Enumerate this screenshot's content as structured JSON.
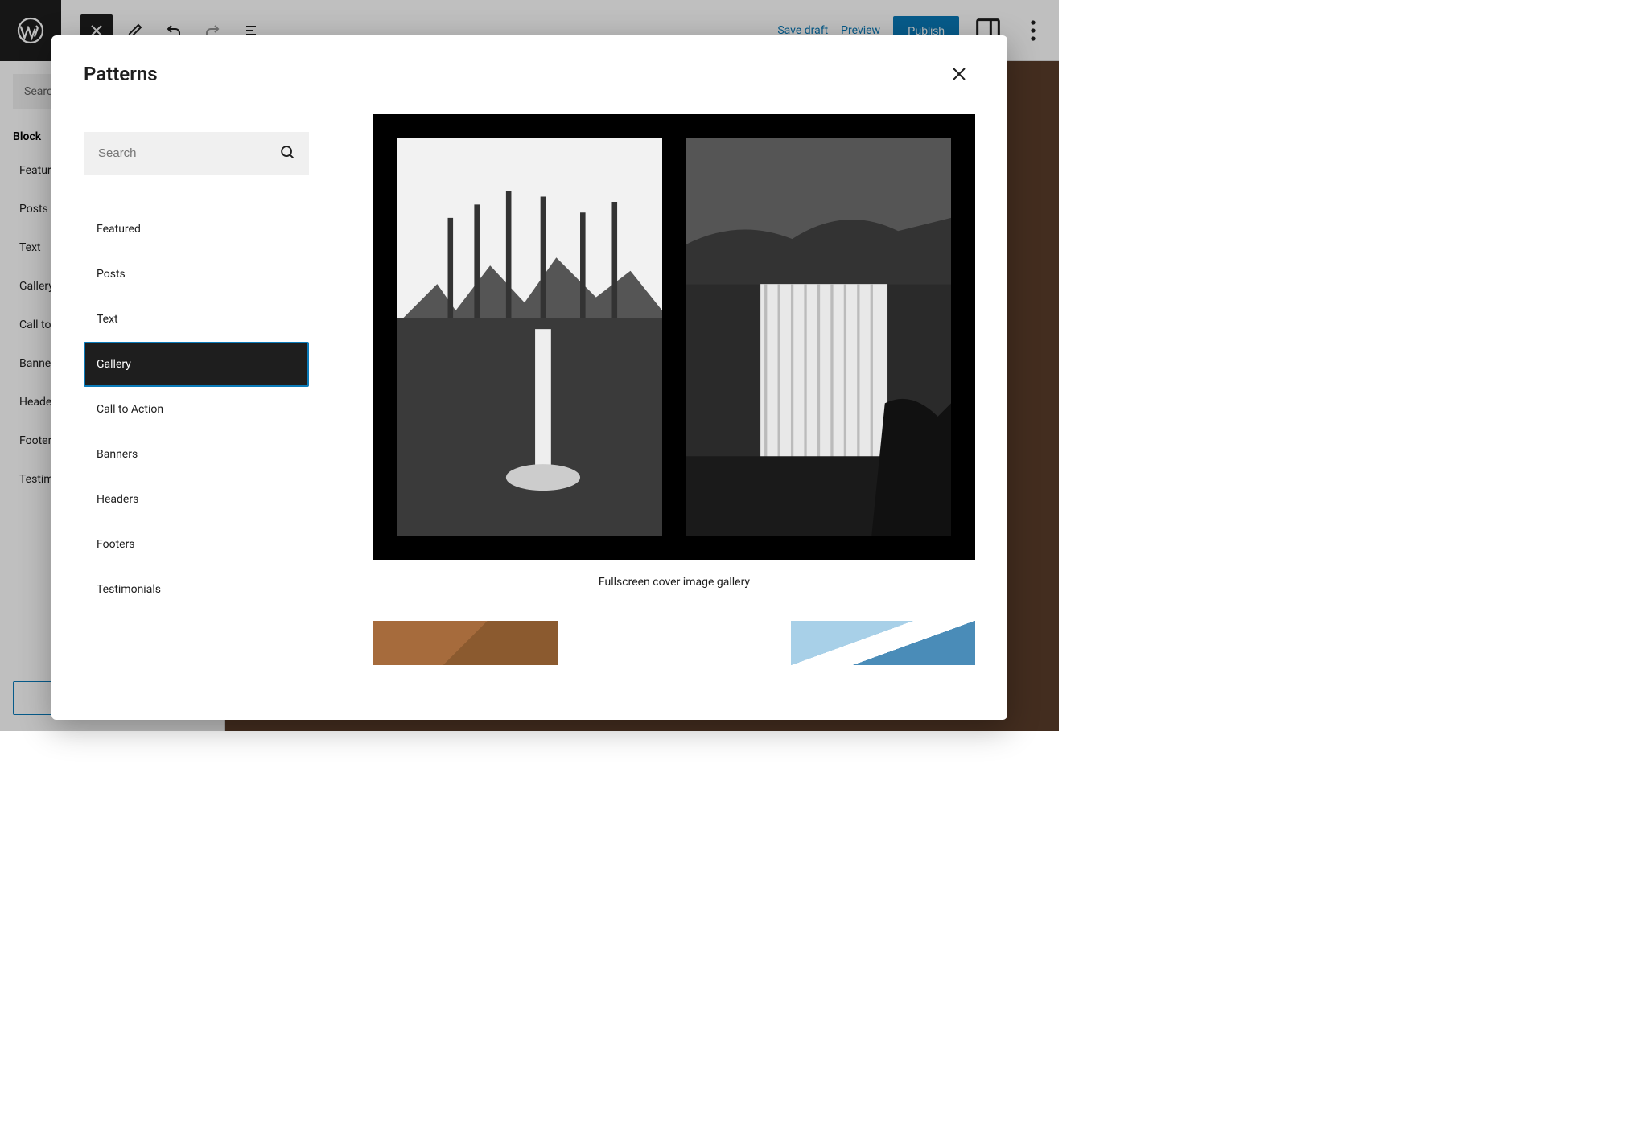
{
  "topbar": {
    "save_draft": "Save draft",
    "preview": "Preview",
    "publish": "Publish"
  },
  "sidebar": {
    "search_placeholder": "Search",
    "panel_title": "Block",
    "categories": [
      "Featured",
      "Posts",
      "Text",
      "Gallery",
      "Call to Action",
      "Banners",
      "Headers",
      "Footers",
      "Testimonials"
    ]
  },
  "modal": {
    "title": "Patterns",
    "search_placeholder": "Search",
    "categories": [
      {
        "label": "Featured",
        "active": false
      },
      {
        "label": "Posts",
        "active": false
      },
      {
        "label": "Text",
        "active": false
      },
      {
        "label": "Gallery",
        "active": true
      },
      {
        "label": "Call to Action",
        "active": false
      },
      {
        "label": "Banners",
        "active": false
      },
      {
        "label": "Headers",
        "active": false
      },
      {
        "label": "Footers",
        "active": false
      },
      {
        "label": "Testimonials",
        "active": false
      }
    ],
    "patterns": [
      {
        "caption": "Fullscreen cover image gallery"
      }
    ]
  }
}
